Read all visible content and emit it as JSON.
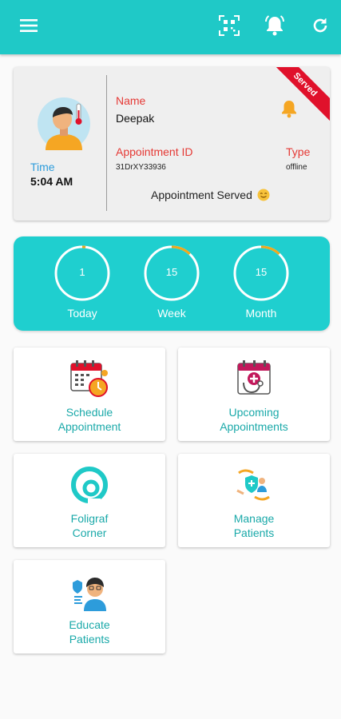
{
  "appbar": {
    "icons": [
      "menu-icon",
      "qr-scan-icon",
      "notification-bell-icon",
      "refresh-icon"
    ],
    "color": "#1fc9c7"
  },
  "appointment": {
    "time_label": "Time",
    "time_value": "5:04 AM",
    "name_label": "Name",
    "name_value": "Deepak",
    "id_label": "Appointment ID",
    "id_value": "31DrXY33936",
    "type_label": "Type",
    "type_value": "offline",
    "status_text": "Appointment Served",
    "ribbon": "Served"
  },
  "stats": [
    {
      "value": "1",
      "label": "Today",
      "progress": 0.02
    },
    {
      "value": "15",
      "label": "Week",
      "progress": 0.12
    },
    {
      "value": "15",
      "label": "Month",
      "progress": 0.12
    }
  ],
  "tiles": {
    "schedule": {
      "line1": "Schedule",
      "line2": "Appointment"
    },
    "upcoming": {
      "line1": "Upcoming",
      "line2": "Appointments"
    },
    "foligraf": {
      "line1": "Foligraf",
      "line2": "Corner"
    },
    "manage": {
      "line1": "Manage",
      "line2": "Patients"
    },
    "educate": {
      "line1": "Educate",
      "line2": "Patients"
    }
  },
  "colors": {
    "accent": "#1fc9c7",
    "label_red": "#e53935",
    "time_blue": "#2d9cdb",
    "ribbon_red": "#e0112b",
    "progress_orange": "#f0a81c",
    "tile_text": "#1aa9a9"
  }
}
